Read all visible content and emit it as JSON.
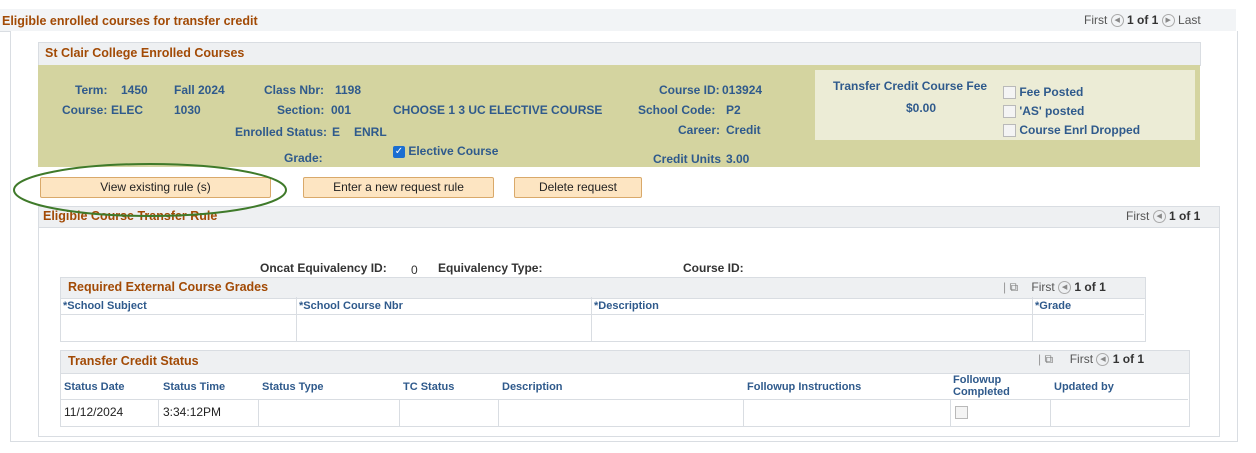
{
  "page": {
    "title": "Eligible enrolled courses for transfer credit",
    "pager": {
      "first": "First",
      "range": "1 of 1",
      "last": "Last"
    }
  },
  "enrolled": {
    "section_title": "St Clair College Enrolled Courses",
    "term_label": "Term:",
    "term_value": "1450",
    "term_name": "Fall 2024",
    "class_nbr_label": "Class Nbr:",
    "class_nbr_value": "1198",
    "course_label": "Course:",
    "course_subject": "ELEC",
    "course_number": "1030",
    "section_label": "Section:",
    "section_value": "001",
    "course_desc": "CHOOSE 1 3 UC ELECTIVE COURSE",
    "enrolled_status_label": "Enrolled Status:",
    "enrolled_status_code": "E",
    "enrolled_status_desc": "ENRL",
    "grade_label": "Grade:",
    "elective_label": "Elective Course",
    "course_id_label": "Course ID:",
    "course_id_value": "013924",
    "school_code_label": "School Code:",
    "school_code_value": "P2",
    "career_label": "Career:",
    "career_value": "Credit",
    "credit_units_label": "Credit Units",
    "credit_units_value": "3.00",
    "fee_title": "Transfer Credit Course Fee",
    "fee_value": "$0.00",
    "fee_posted_label": "Fee Posted",
    "as_posted_label": "'AS' posted",
    "enrl_dropped_label": "Course Enrl Dropped"
  },
  "buttons": {
    "view_rule": "View existing rule (s)",
    "new_rule": "Enter a new request rule",
    "delete": "Delete request"
  },
  "rule": {
    "title": "Eligible Course Transfer Rule",
    "pager": {
      "first": "First",
      "range": "1 of 1"
    },
    "oncat_label": "Oncat Equivalency ID:",
    "oncat_value": "0",
    "equiv_type_label": "Equivalency Type:",
    "course_id_label": "Course ID:"
  },
  "grades": {
    "title": "Required External Course Grades",
    "pager": {
      "first": "First",
      "range": "1 of 1"
    },
    "columns": [
      "*School Subject",
      "*School Course Nbr",
      "*Description",
      "*Grade"
    ]
  },
  "status": {
    "title": "Transfer Credit Status",
    "pager": {
      "first": "First",
      "range": "1 of 1"
    },
    "columns": [
      "Status Date",
      "Status Time",
      "Status Type",
      "TC Status",
      "Description",
      "Followup Instructions",
      "Followup Completed",
      "Updated by"
    ],
    "rows": [
      {
        "date": "11/12/2024",
        "time": "3:34:12PM",
        "type": "",
        "tc_status": "",
        "description": "",
        "followup": "",
        "updated_by": ""
      }
    ]
  },
  "colors": {
    "accent_title": "#a24a05",
    "label_blue": "#2f5a8c",
    "olive_bg": "#d4d4a0",
    "annotation_green": "#3f7a2a"
  }
}
